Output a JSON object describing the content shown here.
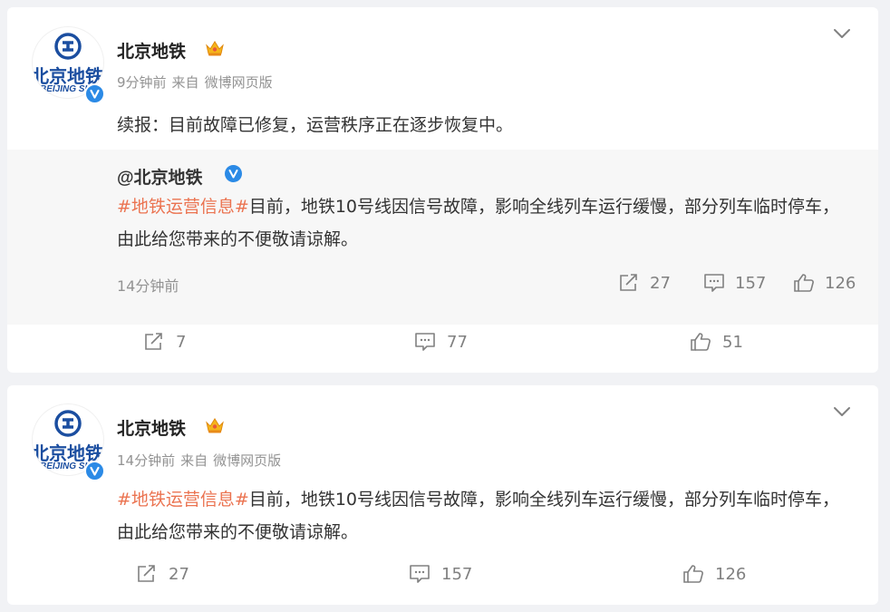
{
  "colors": {
    "background": "#f1f2f5",
    "card": "#ffffff",
    "quote_background": "#f7f7f7",
    "topic_tag": "#eb7350",
    "verified_badge": "#2b8ae6",
    "meta_text": "#939393"
  },
  "avatar": {
    "logo_icon": "beijing-subway-logo",
    "name_cn": "北京地铁",
    "name_en": "BEIJING SUBWAY"
  },
  "posts": [
    {
      "author": "北京地铁",
      "time": "9分钟前",
      "source_prefix": "来自",
      "source": "微博网页版",
      "text": "续报：目前故障已修复，运营秩序正在逐步恢复中。",
      "repost": {
        "author": "@北京地铁",
        "topic": "#地铁运营信息#",
        "text": "目前，地铁10号线因信号故障，影响全线列车运行缓慢，部分列车临时停车，由此给您带来的不便敬请谅解。",
        "time": "14分钟前",
        "reposts": "27",
        "comments": "157",
        "likes": "126"
      },
      "reposts": "7",
      "comments": "77",
      "likes": "51"
    },
    {
      "author": "北京地铁",
      "time": "14分钟前",
      "source_prefix": "来自",
      "source": "微博网页版",
      "topic": "#地铁运营信息#",
      "text": "目前，地铁10号线因信号故障，影响全线列车运行缓慢，部分列车临时停车，由此给您带来的不便敬请谅解。",
      "reposts": "27",
      "comments": "157",
      "likes": "126"
    }
  ]
}
